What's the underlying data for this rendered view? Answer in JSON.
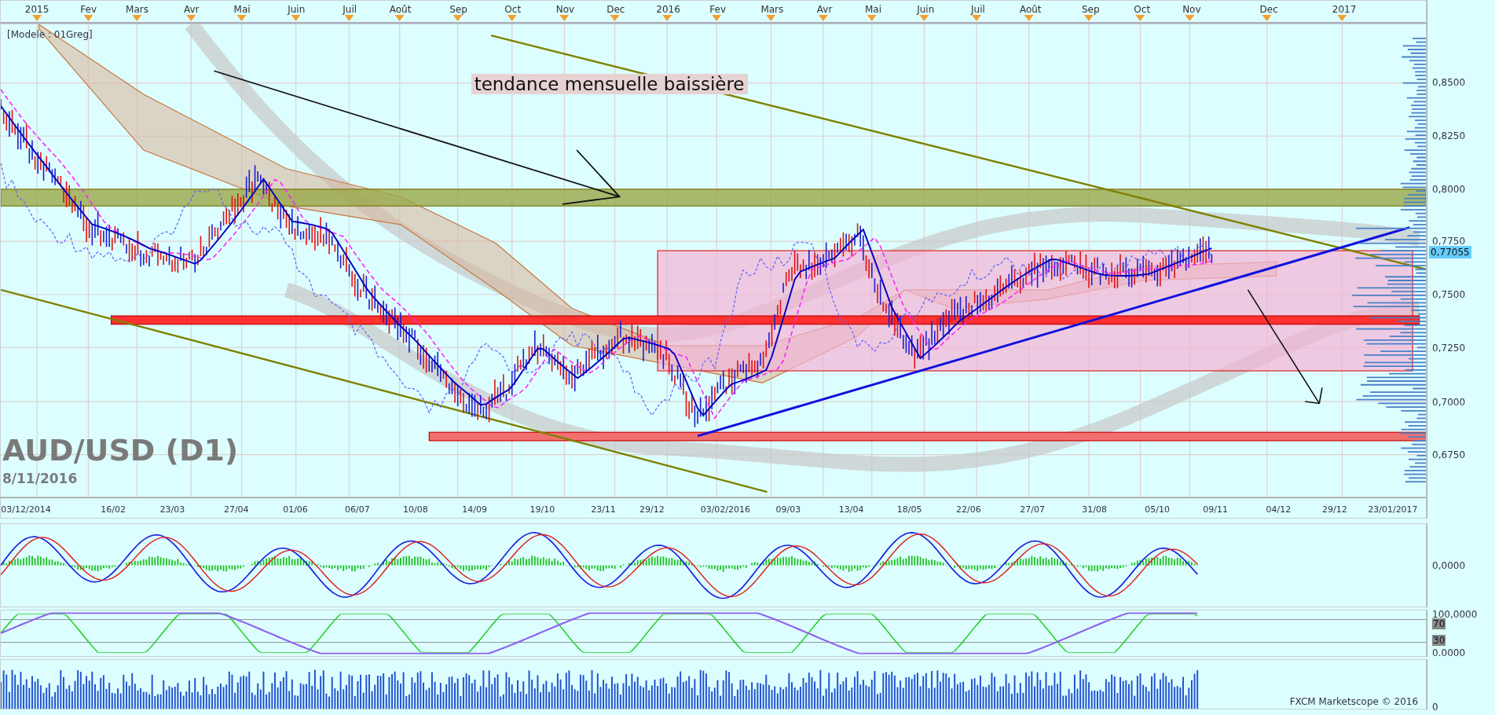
{
  "top_axis": {
    "months": [
      "2015",
      "Fev",
      "Mars",
      "Avr",
      "Mai",
      "Juin",
      "Juil",
      "Août",
      "Sep",
      "Oct",
      "Nov",
      "Dec",
      "2016",
      "Fev",
      "Mars",
      "Avr",
      "Mai",
      "Juin",
      "Juil",
      "Août",
      "Sep",
      "Oct",
      "Nov",
      "Dec",
      "2017"
    ]
  },
  "chart": {
    "template": "[Modele : 01Greg]",
    "annotation": "tendance mensuelle baissière",
    "symbol": "AUD/USD (D1)",
    "date": "8/11/2016",
    "current_price": "0,77055",
    "price_ticks": [
      "0,8500",
      "0,8250",
      "0,8000",
      "0,7750",
      "0,7500",
      "0,7250",
      "0,7000",
      "0,6750"
    ]
  },
  "date_axis": {
    "dates": [
      "03/12/2014",
      "16/02",
      "23/03",
      "27/04",
      "01/06",
      "06/07",
      "10/08",
      "14/09",
      "19/10",
      "23/11",
      "29/12",
      "03/02/2016",
      "09/03",
      "13/04",
      "18/05",
      "22/06",
      "27/07",
      "31/08",
      "05/10",
      "09/11",
      "04/12",
      "29/12",
      "23/01/2017"
    ]
  },
  "panels": [
    {
      "kind": "oscillator",
      "ticks": [
        "0,0000"
      ]
    },
    {
      "kind": "stochastic",
      "ticks": [
        "100,0000",
        "0.0000"
      ],
      "levels": [
        "70",
        "30"
      ]
    },
    {
      "kind": "volume",
      "ticks": [
        "0"
      ],
      "footer": "FXCM Marketscope © 2016"
    }
  ]
}
